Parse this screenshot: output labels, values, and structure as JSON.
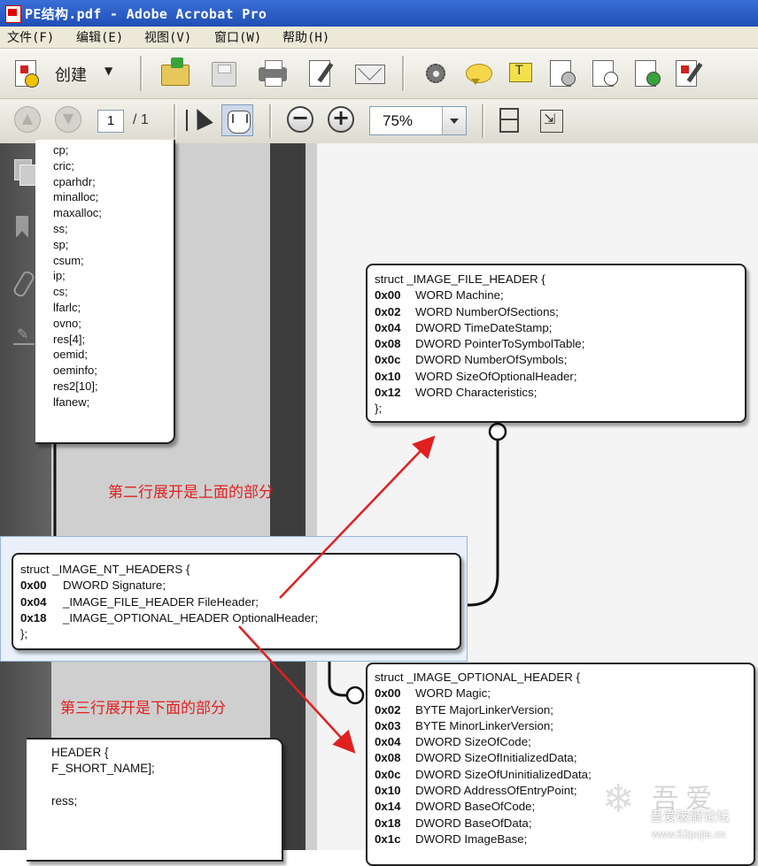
{
  "window": {
    "title": "PE结构.pdf - Adobe Acrobat Pro"
  },
  "menu": [
    {
      "label": "文件(F)"
    },
    {
      "label": "编辑(E)"
    },
    {
      "label": "视图(V)"
    },
    {
      "label": "窗口(W)"
    },
    {
      "label": "帮助(H)"
    }
  ],
  "toolbar": {
    "create_label": "创建"
  },
  "navigation": {
    "page_current": "1",
    "page_total": "/ 1",
    "zoom": "75%"
  },
  "doc": {
    "left_fields": [
      "cp;",
      "cric;",
      "cparhdr;",
      "minalloc;",
      "maxalloc;",
      "ss;",
      "sp;",
      "csum;",
      "ip;",
      "cs;",
      "lfarlc;",
      "ovno;",
      "res[4];",
      "oemid;",
      "oeminfo;",
      "res2[10];",
      "lfanew;"
    ],
    "file_header": {
      "title": "struct _IMAGE_FILE_HEADER {",
      "rows": [
        {
          "off": "0x00",
          "field": "WORD Machine;"
        },
        {
          "off": "0x02",
          "field": "WORD NumberOfSections;"
        },
        {
          "off": "0x04",
          "field": "DWORD TimeDateStamp;"
        },
        {
          "off": "0x08",
          "field": "DWORD PointerToSymbolTable;"
        },
        {
          "off": "0x0c",
          "field": "DWORD NumberOfSymbols;"
        },
        {
          "off": "0x10",
          "field": "WORD SizeOfOptionalHeader;"
        },
        {
          "off": "0x12",
          "field": "WORD Characteristics;"
        }
      ],
      "close": "};"
    },
    "nt_headers": {
      "title": "struct _IMAGE_NT_HEADERS {",
      "rows": [
        {
          "off": "0x00",
          "field": "DWORD Signature;"
        },
        {
          "off": "0x04",
          "field": "_IMAGE_FILE_HEADER FileHeader;"
        },
        {
          "off": "0x18",
          "field": "_IMAGE_OPTIONAL_HEADER OptionalHeader;"
        }
      ],
      "close": "};"
    },
    "optional_header": {
      "title": "struct _IMAGE_OPTIONAL_HEADER {",
      "rows": [
        {
          "off": "0x00",
          "field": "WORD Magic;"
        },
        {
          "off": "0x02",
          "field": "BYTE MajorLinkerVersion;"
        },
        {
          "off": "0x03",
          "field": "BYTE MinorLinkerVersion;"
        },
        {
          "off": "0x04",
          "field": "DWORD SizeOfCode;"
        },
        {
          "off": "0x08",
          "field": "DWORD SizeOfInitializedData;"
        },
        {
          "off": "0x0c",
          "field": "DWORD SizeOfUninitializedData;"
        },
        {
          "off": "0x10",
          "field": "DWORD AddressOfEntryPoint;"
        },
        {
          "off": "0x14",
          "field": "DWORD BaseOfCode;"
        },
        {
          "off": "0x18",
          "field": "DWORD BaseOfData;"
        },
        {
          "off": "0x1c",
          "field": "DWORD ImageBase;"
        }
      ]
    },
    "section_header": {
      "lines": [
        "HEADER {",
        "F_SHORT_NAME];",
        "",
        "ress;"
      ]
    }
  },
  "annotations": {
    "upper": "第二行展开是上面的部分",
    "lower": "第三行展开是下面的部分",
    "arrow_color": "#e02020"
  },
  "watermark": {
    "big": "吾爱",
    "cn": "吾爱破解论坛",
    "url": "www.52pojie.cn"
  }
}
